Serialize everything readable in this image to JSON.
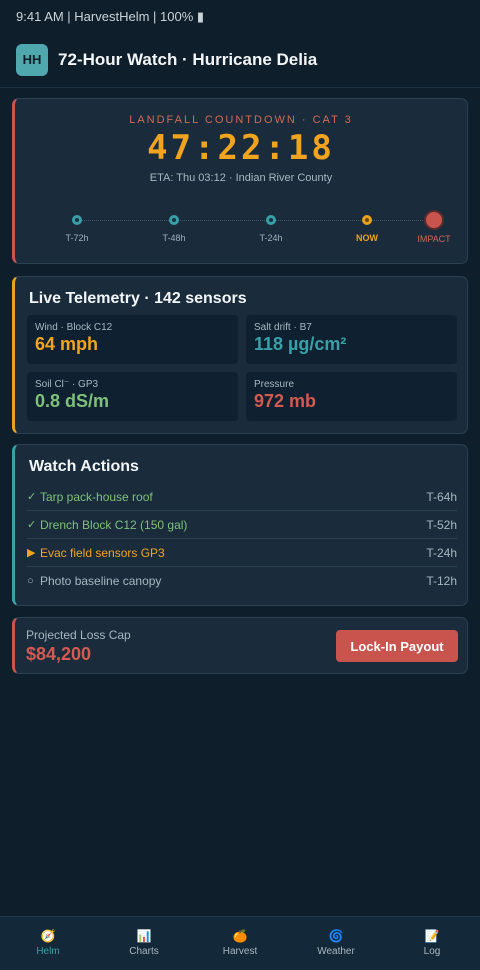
{
  "status_bar": {
    "text": "9:41 AM | HarvestHelm | 100% ▮"
  },
  "header": {
    "logo_text": "HH",
    "title": "72-Hour Watch · Hurricane Delia"
  },
  "countdown": {
    "label": "LANDFALL COUNTDOWN · CAT 3",
    "timer": "47:22:18",
    "eta": "ETA: Thu 03:12 · Indian River County",
    "timeline": [
      {
        "label": "T-72h",
        "state": "past"
      },
      {
        "label": "T-48h",
        "state": "past"
      },
      {
        "label": "T-24h",
        "state": "past"
      },
      {
        "label": "NOW",
        "state": "now"
      },
      {
        "label": "IMPACT",
        "state": "impact"
      }
    ]
  },
  "telemetry": {
    "title": "Live Telemetry · 142 sensors",
    "tiles": [
      {
        "label": "Wind · Block C12",
        "value": "64 mph",
        "color": "#f2a41f"
      },
      {
        "label": "Salt drift · B7",
        "value": "118 µg/cm²",
        "color": "#3aa0a8"
      },
      {
        "label": "Soil Cl⁻ · GP3",
        "value": "0.8 dS/m",
        "color": "#7fc07a"
      },
      {
        "label": "Pressure",
        "value": "972 mb",
        "color": "#d35a50"
      }
    ]
  },
  "actions": {
    "title": "Watch Actions",
    "items": [
      {
        "icon": "✓",
        "icon_name": "check-icon",
        "text": "Tarp pack-house roof",
        "time": "T-64h",
        "state": "done"
      },
      {
        "icon": "✓",
        "icon_name": "check-icon",
        "text": "Drench Block C12 (150 gal)",
        "time": "T-52h",
        "state": "done"
      },
      {
        "icon": "▶",
        "icon_name": "play-icon",
        "text": "Evac field sensors GP3",
        "time": "T-24h",
        "state": "active"
      },
      {
        "icon": "○",
        "icon_name": "circle-icon",
        "text": "Photo baseline canopy",
        "time": "T-12h",
        "state": "todo"
      }
    ]
  },
  "loss": {
    "label": "Projected Loss Cap",
    "value": "$84,200",
    "button_label": "Lock-In Payout"
  },
  "tabbar": {
    "tabs": [
      {
        "icon": "🧭",
        "icon_name": "compass-icon",
        "label": "Helm",
        "active": true
      },
      {
        "icon": "📊",
        "icon_name": "chart-icon",
        "label": "Charts",
        "active": false
      },
      {
        "icon": "🍊",
        "icon_name": "orange-icon",
        "label": "Harvest",
        "active": false
      },
      {
        "icon": "🌀",
        "icon_name": "cyclone-icon",
        "label": "Weather",
        "active": false
      },
      {
        "icon": "📝",
        "icon_name": "memo-icon",
        "label": "Log",
        "active": false
      }
    ]
  }
}
